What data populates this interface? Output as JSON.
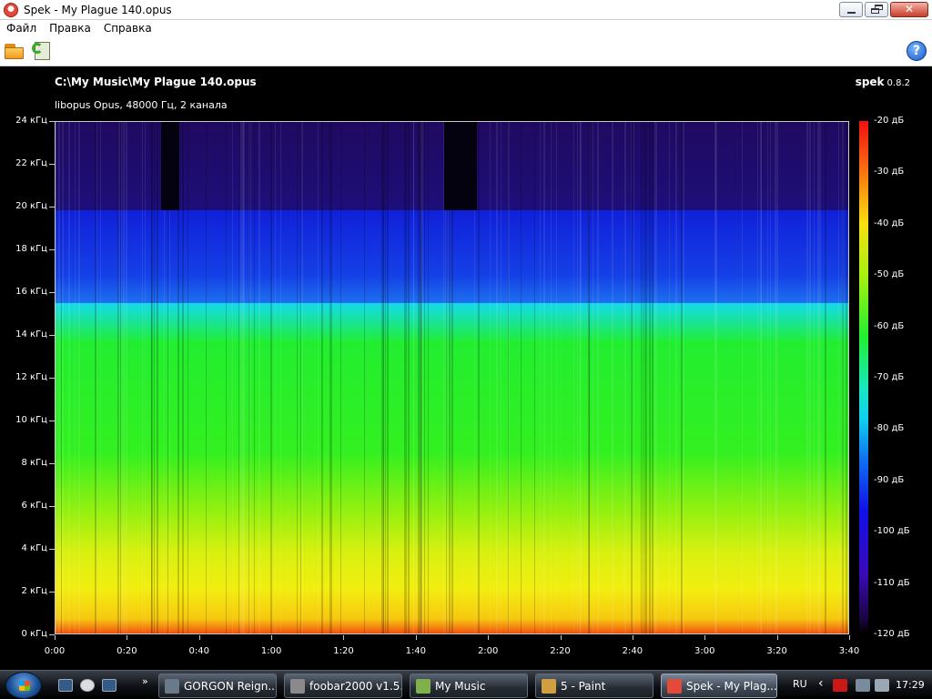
{
  "window": {
    "title": "Spek - My Plague 140.opus"
  },
  "menu": {
    "items": [
      "Файл",
      "Правка",
      "Справка"
    ]
  },
  "toolbar": {
    "open_icon": "folder-open-icon",
    "save_icon": "save-icon",
    "help_icon": "help-icon"
  },
  "main": {
    "file_path": "C:\\My Music\\My Plague 140.opus",
    "file_info": "libopus Opus, 48000 Гц, 2 канала",
    "brand": "spek",
    "version": "0.8.2"
  },
  "chart_data": {
    "type": "heatmap",
    "title": "",
    "y_tick_labels": [
      "24 кГц",
      "22 кГц",
      "20 кГц",
      "18 кГц",
      "16 кГц",
      "14 кГц",
      "12 кГц",
      "10 кГц",
      "8 кГц",
      "6 кГц",
      "4 кГц",
      "2 кГц",
      "0 кГц"
    ],
    "y_range_khz": [
      0,
      24
    ],
    "x_tick_labels": [
      "0:00",
      "0:20",
      "0:40",
      "1:00",
      "1:20",
      "1:40",
      "2:00",
      "2:20",
      "2:40",
      "3:00",
      "3:20",
      "3:40"
    ],
    "x_range_seconds": [
      0,
      220
    ],
    "colorbar_labels": [
      "-20 дБ",
      "-30 дБ",
      "-40 дБ",
      "-50 дБ",
      "-60 дБ",
      "-70 дБ",
      "-80 дБ",
      "-90 дБ",
      "-100 дБ",
      "-110 дБ",
      "-120 дБ"
    ],
    "colorbar_range_db": [
      -120,
      -20
    ]
  },
  "taskbar": {
    "tasks": [
      {
        "label": "GORGON Reign...",
        "active": false,
        "color": "#6a7a8a"
      },
      {
        "label": "foobar2000 v1.5...",
        "active": false,
        "color": "#8a8a8a"
      },
      {
        "label": "My Music",
        "active": false,
        "color": "#7fb04a"
      },
      {
        "label": "5 - Paint",
        "active": false,
        "color": "#d0a040"
      },
      {
        "label": "Spek - My Plag...",
        "active": true,
        "color": "#e34a3a"
      }
    ],
    "lang": "RU",
    "clock": "17:29"
  }
}
